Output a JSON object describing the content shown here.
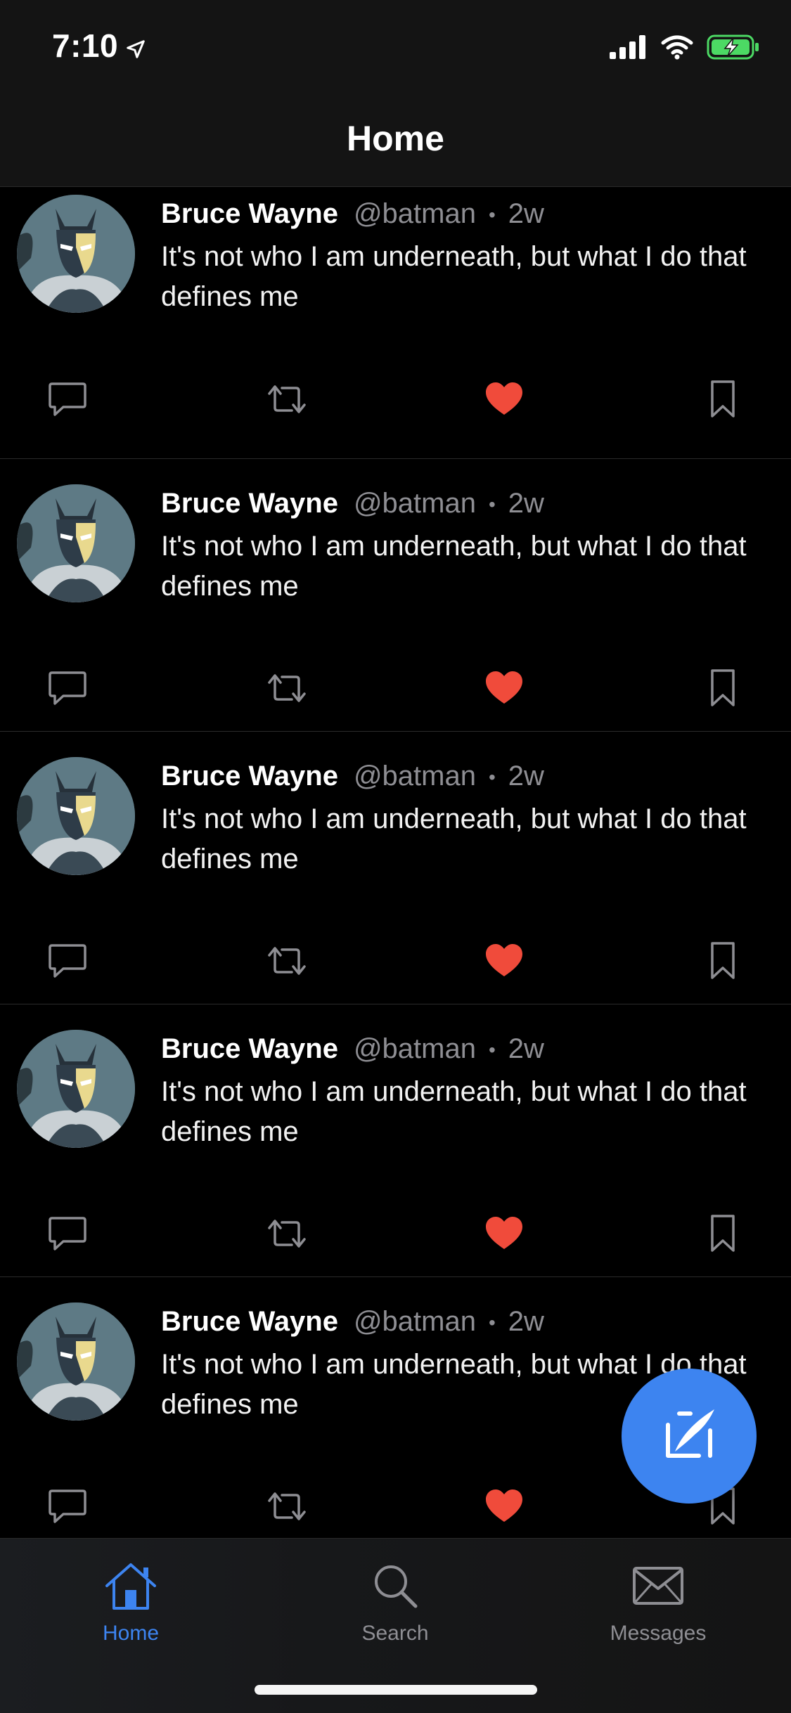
{
  "status_bar": {
    "time": "7:10"
  },
  "header": {
    "title": "Home"
  },
  "posts": [
    {
      "name": "Bruce Wayne",
      "handle": "@batman",
      "separator": "•",
      "time": "2w",
      "text": "It's not who I am underneath, but what I do that defines me"
    },
    {
      "name": "Bruce Wayne",
      "handle": "@batman",
      "separator": "•",
      "time": "2w",
      "text": "It's not who I am underneath, but what I do that defines me"
    },
    {
      "name": "Bruce Wayne",
      "handle": "@batman",
      "separator": "•",
      "time": "2w",
      "text": "It's not who I am underneath, but what I do that defines me"
    },
    {
      "name": "Bruce Wayne",
      "handle": "@batman",
      "separator": "•",
      "time": "2w",
      "text": "It's not who I am underneath, but what I do that defines me"
    },
    {
      "name": "Bruce Wayne",
      "handle": "@batman",
      "separator": "•",
      "time": "2w",
      "text": "It's not who I am underneath, but what I do that defines me"
    }
  ],
  "tabbar": {
    "home_label": "Home",
    "search_label": "Search",
    "messages_label": "Messages"
  },
  "icons": {
    "post_actions": [
      "comment-icon",
      "retweet-icon",
      "heart-icon",
      "bookmark-icon"
    ],
    "fab": "compose-icon",
    "tabs": [
      "home-icon",
      "search-icon",
      "mail-icon"
    ]
  },
  "colors": {
    "accent": "#3d84f0",
    "like": "#f04b3b",
    "muted": "#8e8e93",
    "background": "#000000",
    "header_background": "#141414"
  }
}
